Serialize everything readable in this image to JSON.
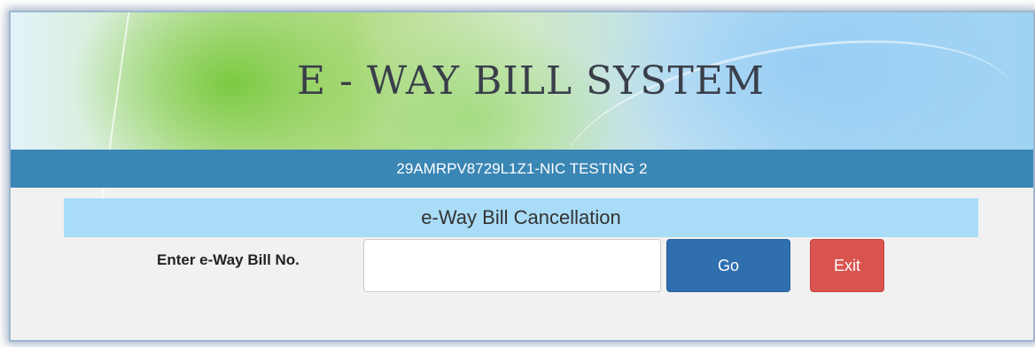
{
  "header": {
    "title": "E - WAY BILL SYSTEM",
    "user_bar": "29AMRPV8729L1Z1-NIC TESTING 2"
  },
  "section": {
    "title": "e-Way Bill Cancellation"
  },
  "form": {
    "field_label": "Enter e-Way Bill No.",
    "field_value": "",
    "go_label": "Go",
    "exit_label": "Exit"
  },
  "colors": {
    "user_bar": "#3a86b4",
    "section_bar": "#a9dcf6",
    "go_button": "#2f6fb0",
    "exit_button": "#d9534f"
  }
}
